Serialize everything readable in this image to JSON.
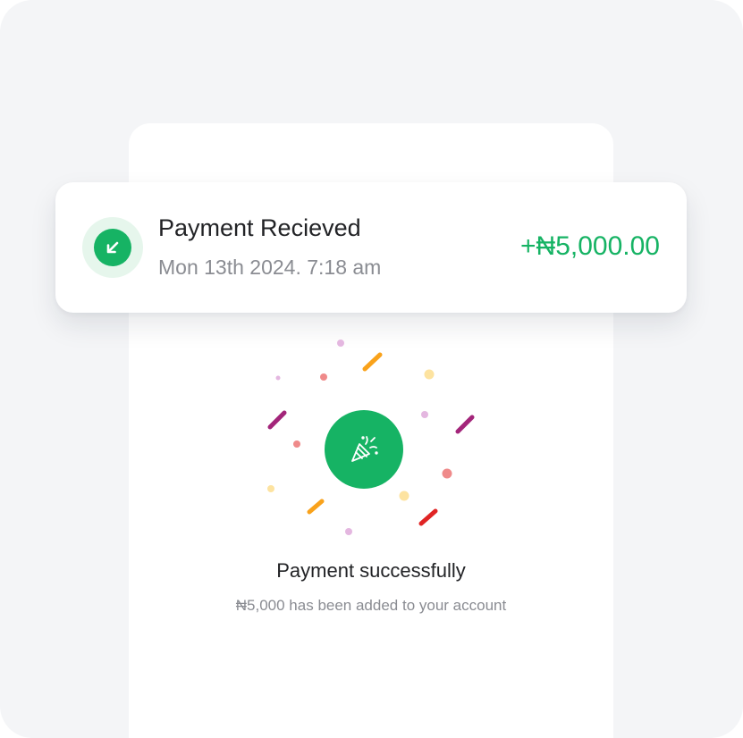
{
  "notification": {
    "icon": "arrow-down-left-icon",
    "title": "Payment Recieved",
    "date": "Mon 13th 2024. 7:18 am",
    "amount": "+₦5,000.00"
  },
  "success": {
    "icon": "party-popper-icon",
    "title": "Payment successfully",
    "subtitle": "₦5,000 has been added to your account"
  },
  "colors": {
    "accent": "#16b364",
    "accent_soft": "#e6f6ec",
    "background": "#f4f5f7",
    "text_primary": "#222326",
    "text_secondary": "#8a8c92"
  }
}
